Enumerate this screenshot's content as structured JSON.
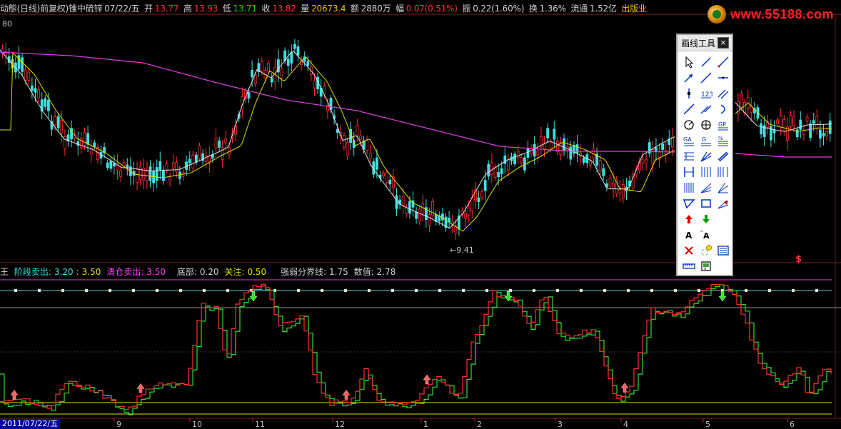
{
  "header": {
    "prefix": "动態(日线)前复权)锥中硫锌",
    "date": "07/22/五",
    "open_label": "开",
    "open": "13.77",
    "high_label": "高",
    "high": "13.93",
    "low_label": "低",
    "low": "13.71",
    "close_label": "收",
    "close": "13.82",
    "volume_label": "量",
    "volume": "20673.4",
    "amount_label": "额",
    "amount": "2880万",
    "change_label": "幅",
    "change": "0.07(0.51%)",
    "amplitude_label": "振",
    "amplitude": "0.22(1.60%)",
    "turnover_label": "换",
    "turnover": "1.36%",
    "float_label": "流通",
    "float": "1.52亿",
    "sector": "出版业"
  },
  "price_axis": {
    "top_label": "80",
    "low_marker": "9.41"
  },
  "watermark": {
    "text": "www.55188.com"
  },
  "indicator": {
    "prefix": "王",
    "stage_sell_label": "阶段卖出:",
    "stage_sell_a": "3.20",
    "stage_sell_b": "3.50",
    "clear_sell_label": "清仓卖出:",
    "clear_sell": "3.50",
    "bottom_label": "底部:",
    "bottom": "0.20",
    "watch_label": "关注:",
    "watch": "0.50",
    "divide_label": "强弱分界线:",
    "divide": "1.75",
    "value_label": "数值:",
    "value": "2.78"
  },
  "time_axis": {
    "first_date": "2011/07/22/五",
    "months": [
      "9",
      "10",
      "11",
      "12",
      "1",
      "2",
      "3",
      "4",
      "5",
      "6"
    ]
  },
  "palette": {
    "title": "画线工具",
    "close": "×",
    "tools": [
      {
        "icon": "pointer-icon"
      },
      {
        "icon": "line-icon"
      },
      {
        "icon": "ray-icon"
      },
      {
        "icon": "arrow-line-icon"
      },
      {
        "icon": "extended-line-icon"
      },
      {
        "icon": "horizontal-ray-icon"
      },
      {
        "icon": "vertical-segment-icon"
      },
      {
        "icon": "wave-number-icon"
      },
      {
        "icon": "parallel-lines-icon"
      },
      {
        "icon": "cross-lines-icon"
      },
      {
        "icon": "double-lines-icon"
      },
      {
        "icon": "arc-icon"
      },
      {
        "icon": "circle-icon"
      },
      {
        "icon": "gann-fan-icon"
      },
      {
        "icon": "gp-icon"
      },
      {
        "icon": "ga-icon"
      },
      {
        "icon": "g-icon"
      },
      {
        "icon": "percent-lines-icon"
      },
      {
        "icon": "fibonacci-icon"
      },
      {
        "icon": "speed-lines-icon"
      },
      {
        "icon": "channel-icon"
      },
      {
        "icon": "bracket-icon"
      },
      {
        "icon": "cycle-lines-icon"
      },
      {
        "icon": "fib-time-icon"
      },
      {
        "icon": "period-icon"
      },
      {
        "icon": "fan-lines-icon"
      },
      {
        "icon": "angle-fan-icon"
      },
      {
        "icon": "triangle-icon"
      },
      {
        "icon": "rectangle-icon"
      },
      {
        "icon": "fan-arrow-icon"
      },
      {
        "icon": "up-arrow-icon"
      },
      {
        "icon": "down-arrow-icon"
      },
      {
        "icon": "blank-icon"
      },
      {
        "icon": "text-icon"
      },
      {
        "icon": "text-note-icon"
      },
      {
        "icon": "blank-icon"
      },
      {
        "icon": "delete-icon"
      },
      {
        "icon": "hide-icon"
      },
      {
        "icon": "list-icon"
      },
      {
        "icon": "ruler-icon"
      },
      {
        "icon": "save-icon"
      }
    ]
  },
  "marker": {
    "symbol": "$"
  },
  "colors": {
    "up": "#ff3030",
    "down": "#40e0e0",
    "ma_short": "#e0e0e0",
    "ma_mid": "#e0e000",
    "ma_long": "#e040e0",
    "ind_up": "#ff3030",
    "ind_down": "#30e030",
    "top_line": "#e040e0",
    "bottom_line": "#e0e000"
  }
}
